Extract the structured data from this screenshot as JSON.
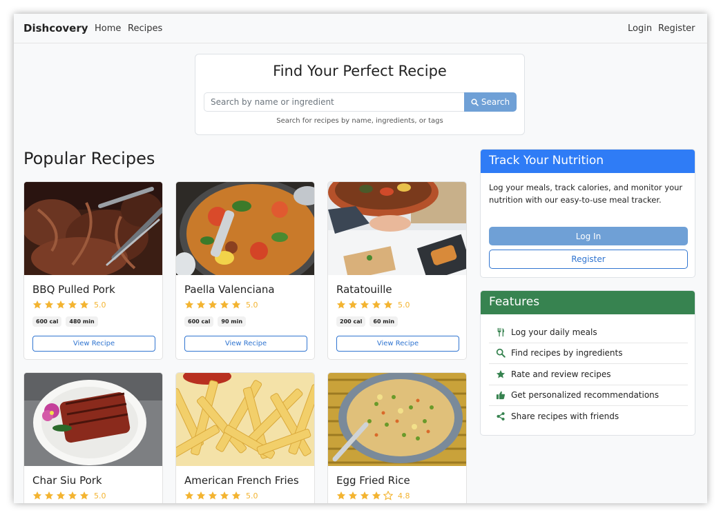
{
  "navbar": {
    "brand": "Dishcovery",
    "links": [
      "Home",
      "Recipes"
    ],
    "auth": [
      "Login",
      "Register"
    ]
  },
  "search": {
    "title": "Find Your Perfect Recipe",
    "placeholder": "Search by name or ingredient",
    "button": "Search",
    "help": "Search for recipes by name, ingredients, or tags"
  },
  "popular": {
    "title": "Popular Recipes",
    "view_label": "View Recipe",
    "recipes": [
      {
        "name": "BBQ Pulled Pork",
        "rating": "5.0",
        "rating_value": 5.0,
        "calories": "600 cal",
        "time": "480 min"
      },
      {
        "name": "Paella Valenciana",
        "rating": "5.0",
        "rating_value": 5.0,
        "calories": "600 cal",
        "time": "90 min"
      },
      {
        "name": "Ratatouille",
        "rating": "5.0",
        "rating_value": 5.0,
        "calories": "200 cal",
        "time": "60 min"
      },
      {
        "name": "Char Siu Pork",
        "rating": "5.0",
        "rating_value": 5.0
      },
      {
        "name": "American French Fries",
        "rating": "5.0",
        "rating_value": 5.0
      },
      {
        "name": "Egg Fried Rice",
        "rating": "4.8",
        "rating_value": 4.0
      }
    ]
  },
  "nutrition": {
    "title": "Track Your Nutrition",
    "text": "Log your meals, track calories, and monitor your nutrition with our easy-to-use meal tracker.",
    "login": "Log In",
    "register": "Register",
    "header_color": "#2f7cf6"
  },
  "features": {
    "title": "Features",
    "header_color": "#378350",
    "items": [
      {
        "icon": "utensils-icon",
        "label": "Log your daily meals"
      },
      {
        "icon": "search-icon",
        "label": "Find recipes by ingredients"
      },
      {
        "icon": "star-icon",
        "label": "Rate and review recipes"
      },
      {
        "icon": "thumbs-up-icon",
        "label": "Get personalized recommendations"
      },
      {
        "icon": "share-icon",
        "label": "Share recipes with friends"
      }
    ]
  },
  "colors": {
    "accent": "#2f74d0",
    "button_muted": "#6fa0d6",
    "star": "#f3b431",
    "feature_icon": "#378350"
  }
}
